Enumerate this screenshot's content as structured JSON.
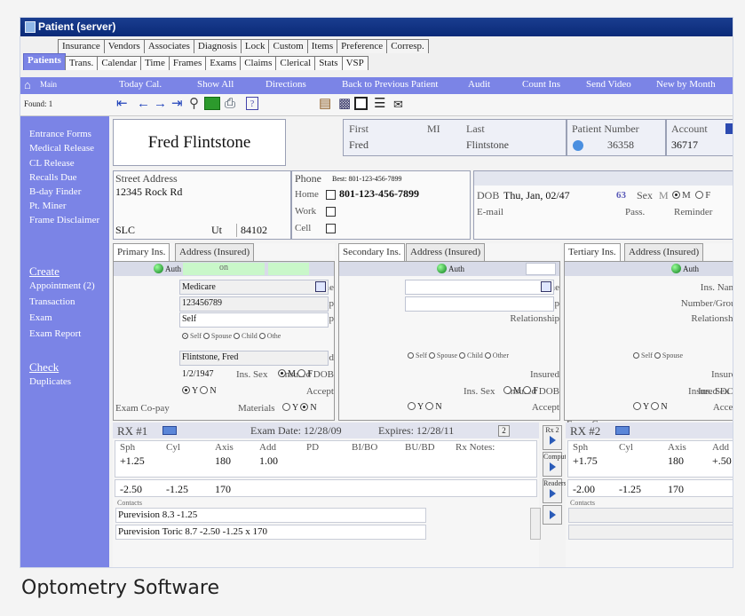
{
  "window": {
    "title": "Patient (server)"
  },
  "tabs_row1": [
    "Insurance",
    "Vendors",
    "Associates",
    "Diagnosis",
    "Lock",
    "Custom",
    "Items",
    "Preference",
    "Corresp."
  ],
  "tabs_row2": [
    "Patients",
    "Trans.",
    "Calendar",
    "Time",
    "Frames",
    "Exams",
    "Claims",
    "Clerical",
    "Stats",
    "VSP"
  ],
  "menu": {
    "main": "Main",
    "items": [
      "Today Cal.",
      "Show All",
      "Directions",
      "Back to Previous Patient",
      "Audit",
      "Count Ins",
      "Send Video",
      "New by Month"
    ]
  },
  "toolbar": {
    "found": "Found: 1"
  },
  "sidebar": {
    "items": [
      "Entrance Forms",
      "Medical Release",
      "CL Release",
      "Recalls Due",
      "B-day Finder",
      "Pt. Miner",
      "Frame Disclaimer"
    ],
    "create": "Create",
    "create_items": [
      "Appointment (2)",
      "Transaction",
      "Exam",
      "Exam Report"
    ],
    "check": "Check",
    "check_items": [
      "Duplicates"
    ]
  },
  "patient": {
    "full_name": "Fred Flintstone",
    "first_label": "First",
    "mi_label": "MI",
    "last_label": "Last",
    "first": "Fred",
    "last": "Flintstone",
    "number_label": "Patient Number",
    "number": "36358",
    "account_label": "Account",
    "account": "36717",
    "street_label": "Street Address",
    "street": "12345 Rock Rd",
    "city": "SLC",
    "state": "Ut",
    "zip": "84102",
    "phone_label": "Phone",
    "best": "Best: 801-123-456-7899",
    "home_label": "Home",
    "home": "801-123-456-7899",
    "work_label": "Work",
    "cell_label": "Cell",
    "dob_label": "DOB",
    "dob": "Thu, Jan, 02/47",
    "age": "63",
    "sex_label": "Sex",
    "sex_value": "M",
    "email_label": "E-mail",
    "pass_label": "Pass.",
    "reminder_label": "Reminder"
  },
  "insurance": {
    "primary": {
      "tab": "Primary Ins.",
      "addr_tab": "Address (Insured)",
      "auth": "Auth",
      "on": "on",
      "name": "Medicare",
      "number": "123456789",
      "relationship": "Self",
      "insured": "Flintstone, Fred",
      "dob": "1/2/1947"
    },
    "secondary": {
      "tab": "Secondary Ins.",
      "addr_tab": "Address (Insured)",
      "auth": "Auth"
    },
    "tertiary": {
      "tab": "Tertiary Ins.",
      "addr_tab": "Address (Insured)",
      "auth": "Auth"
    },
    "labels": {
      "name": "Ins. Name",
      "number": "Number/Group",
      "relationship": "Relationship",
      "self": "Self",
      "spouse": "Spouse",
      "child": "Child",
      "other": "Other",
      "other_short": "Othe",
      "insured": "Insured",
      "insured_dob": "Insured DOB",
      "ins_sex": "Ins. Sex",
      "m": "M",
      "f": "F",
      "accept": "Accept",
      "y": "Y",
      "n": "N",
      "copay": "Exam Co-pay",
      "materials": "Materials"
    }
  },
  "rx": {
    "rx1": "RX #1",
    "exam_date": "Exam Date: 12/28/09",
    "expires": "Expires: 12/28/11",
    "count": "2",
    "rx2": "RX #2",
    "headers": [
      "Sph",
      "Cyl",
      "Axis",
      "Add",
      "PD",
      "BI/BO",
      "BU/BD",
      "Rx Notes:"
    ],
    "rx2_headers": [
      "Sph",
      "Cyl",
      "Axis",
      "Add"
    ],
    "row1": [
      "+1.25",
      "",
      "180",
      "1.00"
    ],
    "row2": [
      "-2.50",
      "-1.25",
      "170"
    ],
    "rx2_row1": [
      "+1.75",
      "",
      "180",
      "+.50"
    ],
    "rx2_row2": [
      "-2.00",
      "-1.25",
      "170"
    ],
    "contacts_label": "Contacts",
    "contacts": [
      "Purevision 8.3  -1.25",
      "Purevision Toric 8.7 -2.50 -1.25 x 170"
    ],
    "side_buttons": [
      "Rx 2",
      "Comput",
      "Readers"
    ]
  },
  "caption": "Optometry Software"
}
